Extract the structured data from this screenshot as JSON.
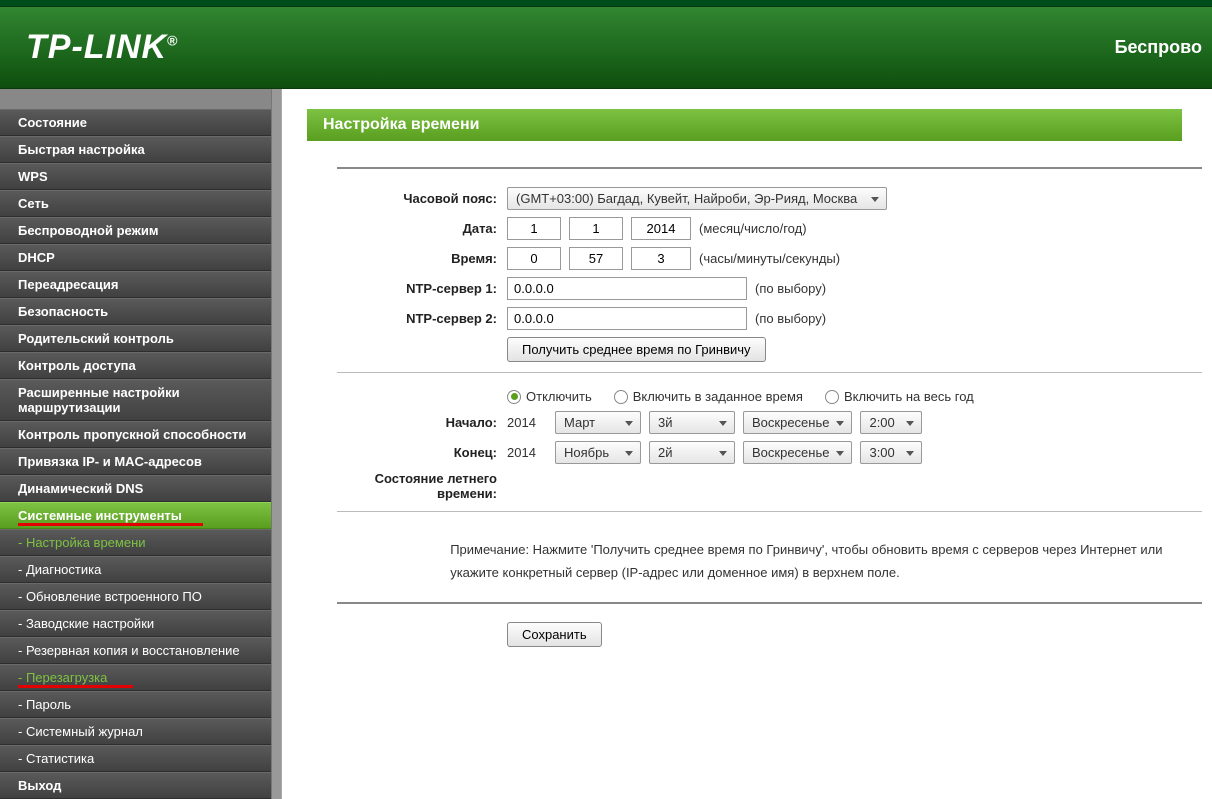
{
  "header": {
    "brand": "TP-LINK",
    "reg": "®",
    "title": "Беспрово"
  },
  "sidebar": {
    "items": [
      "Состояние",
      "Быстрая настройка",
      "WPS",
      "Сеть",
      "Беспроводной режим",
      "DHCP",
      "Переадресация",
      "Безопасность",
      "Родительский контроль",
      "Контроль доступа",
      "Расширенные настройки маршрутизации",
      "Контроль пропускной способности",
      "Привязка IP- и MAC-адресов",
      "Динамический DNS",
      "Системные инструменты"
    ],
    "subitems": [
      "- Настройка времени",
      "- Диагностика",
      "- Обновление встроенного ПО",
      "- Заводские настройки",
      "- Резервная копия и восстановление",
      "- Перезагрузка",
      "- Пароль",
      "- Системный журнал",
      "- Статистика"
    ],
    "exit": "Выход"
  },
  "page": {
    "title": "Настройка времени",
    "labels": {
      "timezone": "Часовой пояс:",
      "date": "Дата:",
      "time": "Время:",
      "ntp1": "NTP-сервер 1:",
      "ntp2": "NTP-сервер 2:",
      "start": "Начало:",
      "end": "Конец:",
      "dst_state": "Состояние летнего времени:"
    },
    "values": {
      "timezone_selected": "(GMT+03:00) Багдад, Кувейт, Найроби, Эр-Рияд, Москва",
      "month": "1",
      "day": "1",
      "year": "2014",
      "date_hint": "(месяц/число/год)",
      "hour": "0",
      "minute": "57",
      "second": "3",
      "time_hint": "(часы/минуты/секунды)",
      "ntp1": "0.0.0.0",
      "ntp2": "0.0.0.0",
      "ntp_hint": "(по выбору)",
      "get_gmt_btn": "Получить среднее время по Гринвичу",
      "radio_disable": "Отключить",
      "radio_enable_range": "Включить в заданное время",
      "radio_enable_year": "Включить на весь год",
      "start_year": "2014",
      "start_month": "Март",
      "start_week": "3й",
      "start_day": "Воскресенье",
      "start_time": "2:00",
      "end_year": "2014",
      "end_month": "Ноябрь",
      "end_week": "2й",
      "end_day": "Воскресенье",
      "end_time": "3:00",
      "note": "Примечание: Нажмите 'Получить среднее время по Гринвичу', чтобы обновить время с серверов через Интернет или укажите конкретный сервер (IP-адрес или доменное имя) в верхнем поле.",
      "save_btn": "Сохранить"
    }
  }
}
